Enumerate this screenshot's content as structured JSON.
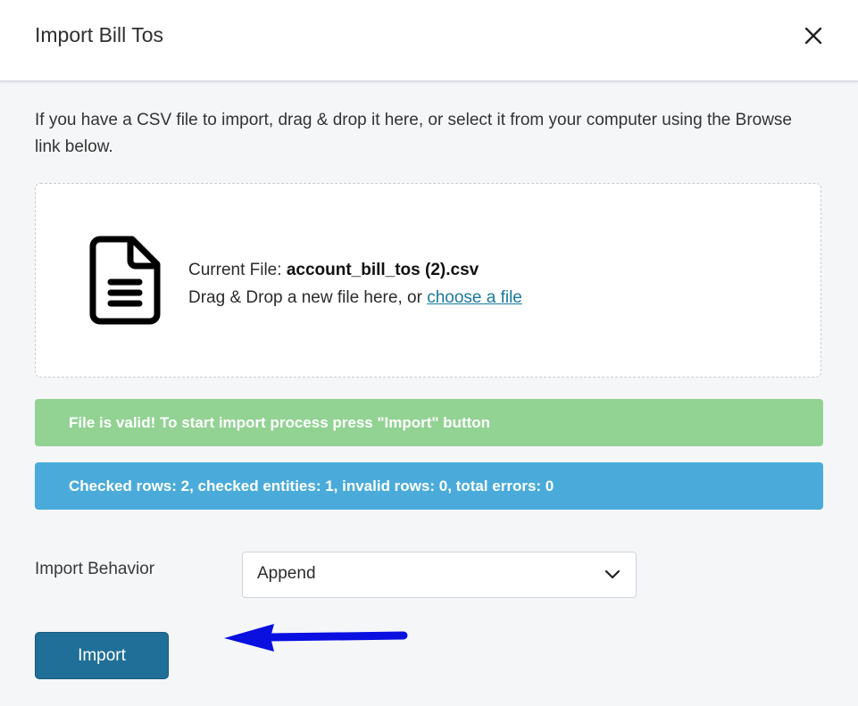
{
  "header": {
    "title": "Import Bill Tos",
    "close_icon": "close-icon"
  },
  "intro": {
    "text": "If you have a CSV file to import, drag & drop it here, or select it from your computer using the Browse link below."
  },
  "dropzone": {
    "icon": "document-icon",
    "current_file_label": "Current File: ",
    "current_file_name": "account_bill_tos (2).csv",
    "drag_text": "Drag & Drop a new file here, or ",
    "choose_link": "choose a file"
  },
  "alerts": {
    "success": "File is valid! To start import process press \"Import\" button",
    "info": "Checked rows: 2, checked entities: 1, invalid rows: 0, total errors: 0"
  },
  "behavior": {
    "label": "Import Behavior",
    "selected": "Append"
  },
  "actions": {
    "import_label": "Import"
  },
  "colors": {
    "success": "#92d293",
    "info": "#4aabdb",
    "primary": "#1f6f98",
    "link": "#1a7a9c",
    "annotation_arrow": "#0a10e0"
  }
}
